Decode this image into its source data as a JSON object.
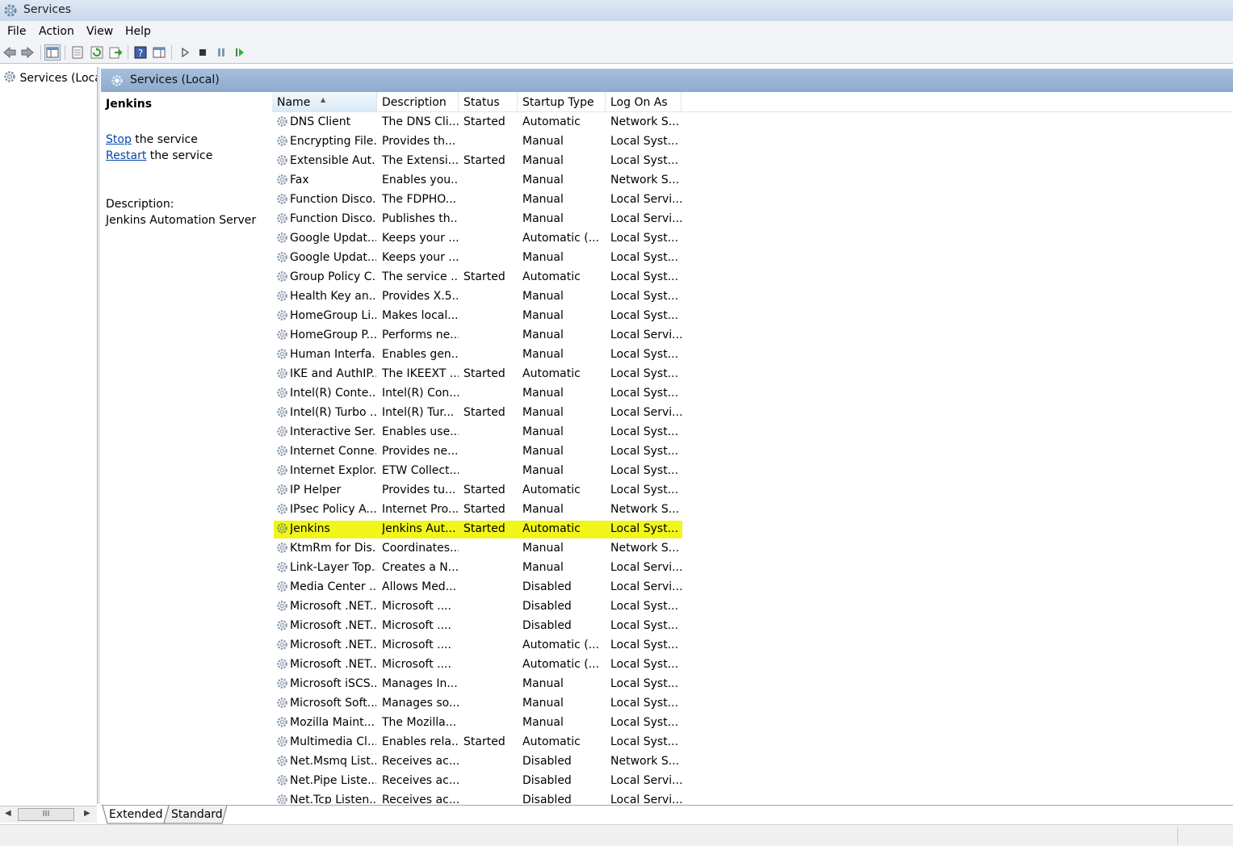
{
  "window": {
    "title": "Services",
    "icon": "services-gear-icon"
  },
  "menu": [
    "File",
    "Action",
    "View",
    "Help"
  ],
  "toolbar": {
    "buttons": [
      "back-icon",
      "forward-icon",
      "show-hide-console-tree-icon",
      "properties-icon",
      "refresh-icon",
      "export-list-icon",
      "help-icon",
      "show-hide-action-pane-icon",
      "start-service-icon",
      "stop-service-icon",
      "pause-service-icon",
      "resume-service-icon"
    ]
  },
  "tree": {
    "item": "Services (Loca"
  },
  "header": {
    "title": "Services (Local)"
  },
  "detail": {
    "name": "Jenkins",
    "stop_link": "Stop",
    "stop_rest": " the service",
    "restart_link": "Restart",
    "restart_rest": " the service",
    "description_label": "Description:",
    "description_text": "Jenkins Automation Server"
  },
  "columns": [
    "Name",
    "Description",
    "Status",
    "Startup Type",
    "Log On As"
  ],
  "rows": [
    {
      "name": "DNS Client",
      "desc": "The DNS Cli...",
      "status": "Started",
      "startup": "Automatic",
      "logon": "Network S..."
    },
    {
      "name": "Encrypting File...",
      "desc": "Provides th...",
      "status": "",
      "startup": "Manual",
      "logon": "Local Syst..."
    },
    {
      "name": "Extensible Aut...",
      "desc": "The Extensi...",
      "status": "Started",
      "startup": "Manual",
      "logon": "Local Syst..."
    },
    {
      "name": "Fax",
      "desc": "Enables you...",
      "status": "",
      "startup": "Manual",
      "logon": "Network S..."
    },
    {
      "name": "Function Disco...",
      "desc": "The FDPHO...",
      "status": "",
      "startup": "Manual",
      "logon": "Local Servi..."
    },
    {
      "name": "Function Disco...",
      "desc": "Publishes th...",
      "status": "",
      "startup": "Manual",
      "logon": "Local Servi..."
    },
    {
      "name": "Google Updat...",
      "desc": "Keeps your ...",
      "status": "",
      "startup": "Automatic (...",
      "logon": "Local Syst..."
    },
    {
      "name": "Google Updat...",
      "desc": "Keeps your ...",
      "status": "",
      "startup": "Manual",
      "logon": "Local Syst..."
    },
    {
      "name": "Group Policy C...",
      "desc": "The service ...",
      "status": "Started",
      "startup": "Automatic",
      "logon": "Local Syst..."
    },
    {
      "name": "Health Key an...",
      "desc": "Provides X.5...",
      "status": "",
      "startup": "Manual",
      "logon": "Local Syst..."
    },
    {
      "name": "HomeGroup Li...",
      "desc": "Makes local...",
      "status": "",
      "startup": "Manual",
      "logon": "Local Syst..."
    },
    {
      "name": "HomeGroup P...",
      "desc": "Performs ne...",
      "status": "",
      "startup": "Manual",
      "logon": "Local Servi..."
    },
    {
      "name": "Human Interfa...",
      "desc": "Enables gen...",
      "status": "",
      "startup": "Manual",
      "logon": "Local Syst..."
    },
    {
      "name": "IKE and AuthIP...",
      "desc": "The IKEEXT ...",
      "status": "Started",
      "startup": "Automatic",
      "logon": "Local Syst..."
    },
    {
      "name": "Intel(R) Conte...",
      "desc": "Intel(R) Con...",
      "status": "",
      "startup": "Manual",
      "logon": "Local Syst..."
    },
    {
      "name": "Intel(R) Turbo ...",
      "desc": "Intel(R) Tur...",
      "status": "Started",
      "startup": "Manual",
      "logon": "Local Servi..."
    },
    {
      "name": "Interactive Ser...",
      "desc": "Enables use...",
      "status": "",
      "startup": "Manual",
      "logon": "Local Syst..."
    },
    {
      "name": "Internet Conne...",
      "desc": "Provides ne...",
      "status": "",
      "startup": "Manual",
      "logon": "Local Syst..."
    },
    {
      "name": "Internet Explor...",
      "desc": "ETW Collect...",
      "status": "",
      "startup": "Manual",
      "logon": "Local Syst..."
    },
    {
      "name": "IP Helper",
      "desc": "Provides tu...",
      "status": "Started",
      "startup": "Automatic",
      "logon": "Local Syst..."
    },
    {
      "name": "IPsec Policy A...",
      "desc": "Internet Pro...",
      "status": "Started",
      "startup": "Manual",
      "logon": "Network S..."
    },
    {
      "name": "Jenkins",
      "desc": "Jenkins Aut...",
      "status": "Started",
      "startup": "Automatic",
      "logon": "Local Syst...",
      "highlighted": true
    },
    {
      "name": "KtmRm for Dis...",
      "desc": "Coordinates...",
      "status": "",
      "startup": "Manual",
      "logon": "Network S..."
    },
    {
      "name": "Link-Layer Top...",
      "desc": "Creates a N...",
      "status": "",
      "startup": "Manual",
      "logon": "Local Servi..."
    },
    {
      "name": "Media Center ...",
      "desc": "Allows Med...",
      "status": "",
      "startup": "Disabled",
      "logon": "Local Servi..."
    },
    {
      "name": "Microsoft .NET...",
      "desc": "Microsoft ....",
      "status": "",
      "startup": "Disabled",
      "logon": "Local Syst..."
    },
    {
      "name": "Microsoft .NET...",
      "desc": "Microsoft ....",
      "status": "",
      "startup": "Disabled",
      "logon": "Local Syst..."
    },
    {
      "name": "Microsoft .NET...",
      "desc": "Microsoft ....",
      "status": "",
      "startup": "Automatic (...",
      "logon": "Local Syst..."
    },
    {
      "name": "Microsoft .NET...",
      "desc": "Microsoft ....",
      "status": "",
      "startup": "Automatic (...",
      "logon": "Local Syst..."
    },
    {
      "name": "Microsoft iSCS...",
      "desc": "Manages In...",
      "status": "",
      "startup": "Manual",
      "logon": "Local Syst..."
    },
    {
      "name": "Microsoft Soft...",
      "desc": "Manages so...",
      "status": "",
      "startup": "Manual",
      "logon": "Local Syst..."
    },
    {
      "name": "Mozilla Maint...",
      "desc": "The Mozilla...",
      "status": "",
      "startup": "Manual",
      "logon": "Local Syst..."
    },
    {
      "name": "Multimedia Cl...",
      "desc": "Enables rela...",
      "status": "Started",
      "startup": "Automatic",
      "logon": "Local Syst..."
    },
    {
      "name": "Net.Msmq List...",
      "desc": "Receives ac...",
      "status": "",
      "startup": "Disabled",
      "logon": "Network S..."
    },
    {
      "name": "Net.Pipe Liste...",
      "desc": "Receives ac...",
      "status": "",
      "startup": "Disabled",
      "logon": "Local Servi..."
    },
    {
      "name": "Net.Tcp Listen...",
      "desc": "Receives ac...",
      "status": "",
      "startup": "Disabled",
      "logon": "Local Servi..."
    }
  ],
  "tabs": [
    "Extended",
    "Standard"
  ],
  "scrollbar": {
    "thumb_glyph": "III"
  },
  "colors": {
    "highlight": "#f1f51a",
    "header_bar": "#9bb6d8",
    "link": "#0645ad"
  }
}
